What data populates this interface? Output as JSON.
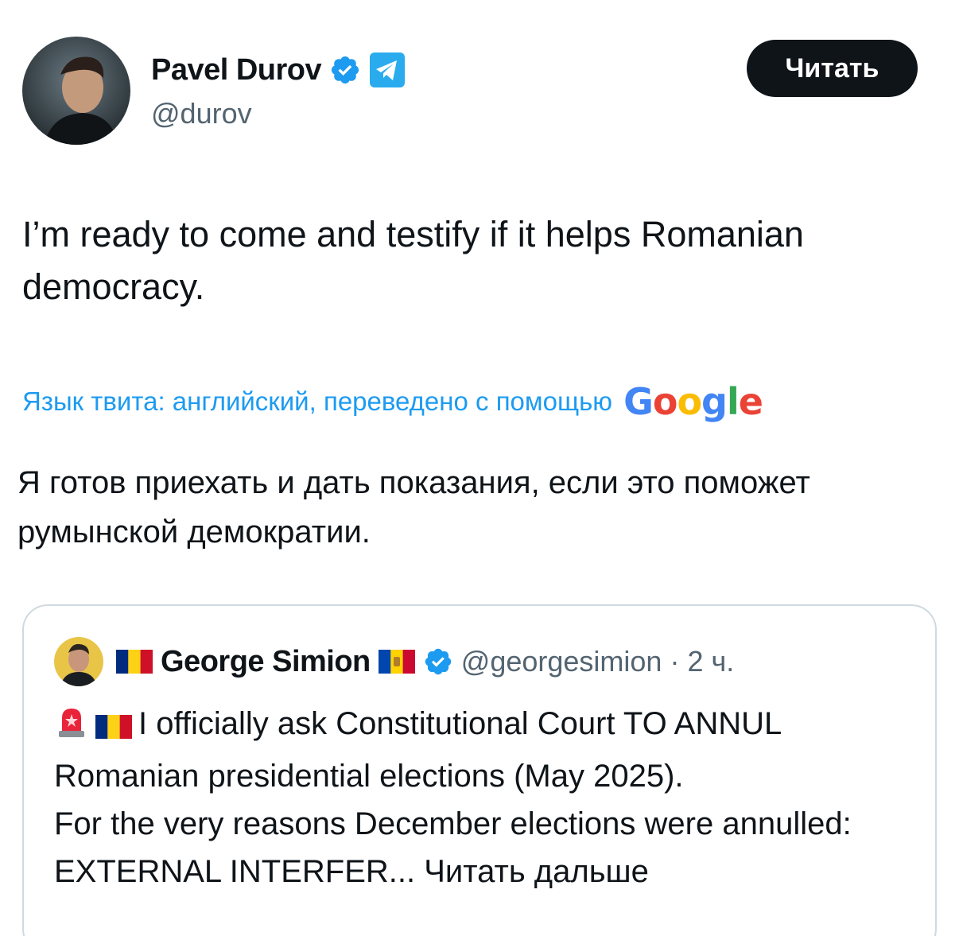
{
  "author": {
    "name": "Pavel Durov",
    "handle": "@durov"
  },
  "follow_button": {
    "label": "Читать"
  },
  "tweet": {
    "text": "I’m ready to come and testify if it helps Romanian democracy."
  },
  "translation": {
    "label": "Язык твита: английский, переведено с помощью",
    "provider": "Google",
    "text": "Я готов приехать и дать показания, если это поможет румынской демократии."
  },
  "quoted_tweet": {
    "author_name": "George Simion",
    "handle": "@georgesimion",
    "separator": "·",
    "time": "2 ч.",
    "text": "I officially ask Constitutional Court TO ANNUL Romanian presidential elections (May 2025).",
    "text2": "For the very reasons December elections were annulled: EXTERNAL INTERFER...",
    "read_more": "Читать дальше"
  },
  "colors": {
    "verified": "#1d9bf0",
    "link": "#1d9bf0",
    "telegram": "#2aabee",
    "button_bg": "#0f1419"
  },
  "icons": {
    "verified": "verified-badge-icon",
    "telegram": "telegram-icon",
    "siren": "siren-icon",
    "flag_ro": "romania-flag-icon",
    "flag_md": "moldova-flag-icon"
  }
}
